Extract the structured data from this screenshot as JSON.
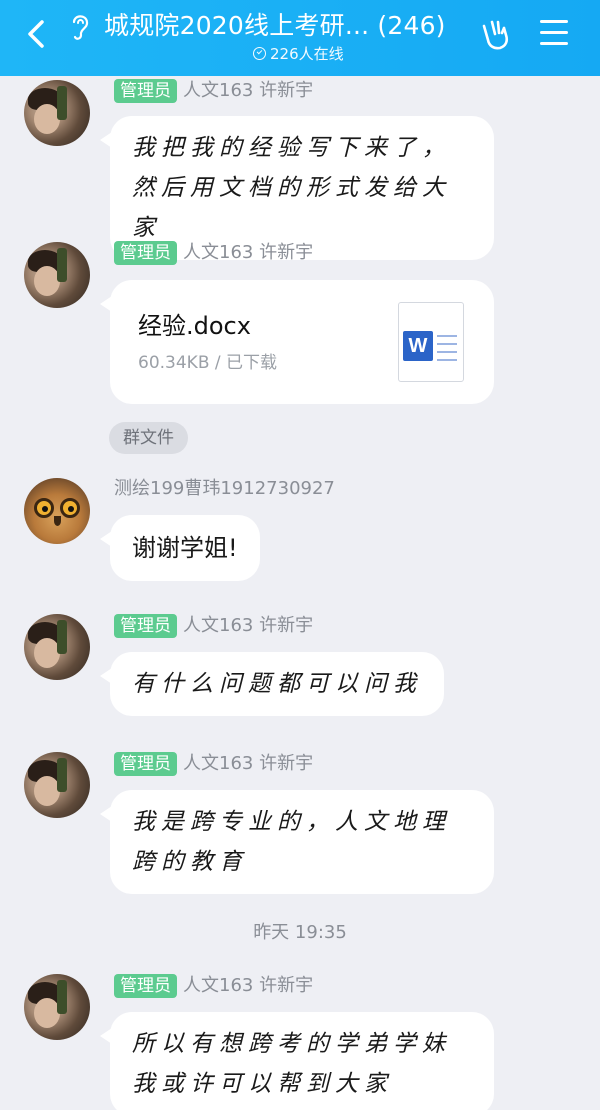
{
  "header": {
    "title": "城规院2020线上考研... (246)",
    "online": "226人在线",
    "icons": {
      "back": "back-arrow-icon",
      "ear": "ear-icon",
      "hand": "gesture-hand-icon",
      "menu": "menu-icon"
    }
  },
  "messages": [
    {
      "badge": "管理员",
      "sender": "人文163 许新宇",
      "text": "我把我的经验写下来了，然后用文档的形式发给大家"
    },
    {
      "badge": "管理员",
      "sender": "人文163 许新宇",
      "file": {
        "name": "经验.docx",
        "meta": "60.34KB / 已下载",
        "icon": "word-file-icon",
        "icon_letter": "W"
      }
    },
    {
      "pill": "群文件"
    },
    {
      "sender": "测绘199曹玮1912730927",
      "text": "谢谢学姐!"
    },
    {
      "badge": "管理员",
      "sender": "人文163 许新宇",
      "text": "有什么问题都可以问我"
    },
    {
      "badge": "管理员",
      "sender": "人文163 许新宇",
      "text": "我是跨专业的，人文地理跨的教育"
    },
    {
      "timestamp": "昨天 19:35"
    },
    {
      "badge": "管理员",
      "sender": "人文163 许新宇",
      "text": "所以有想跨考的学弟学妹我或许可以帮到大家"
    }
  ],
  "colors": {
    "header": "#1fb6f7",
    "badge": "#5ccb8f",
    "background": "#eeeff4",
    "word": "#2b64c8"
  }
}
